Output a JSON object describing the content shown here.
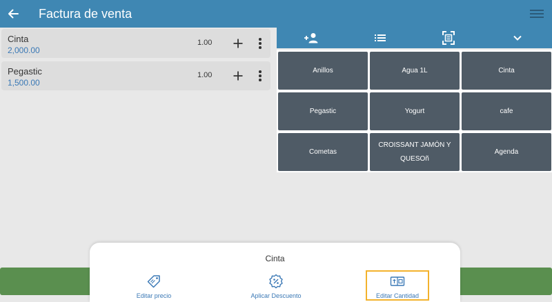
{
  "appbar": {
    "title": "Factura de venta",
    "back_icon": "arrow-left-icon",
    "menu_icon": "hamburger-menu-icon"
  },
  "invoice_lines": [
    {
      "name": "Cinta",
      "price": "2,000.00",
      "qty": "1.00"
    },
    {
      "name": "Pegastic",
      "price": "1,500.00",
      "qty": "1.00"
    }
  ],
  "toolbar": {
    "icons": [
      "add-customer-icon",
      "list-icon",
      "barcode-scan-icon",
      "chevron-down-icon"
    ]
  },
  "products": [
    "Anillos",
    "Agua 1L",
    "Cinta",
    "Pegastic",
    "Yogurt",
    "cafe",
    "Cometas",
    "CROISSANT JAMÓN Y QUESOñ",
    "Agenda"
  ],
  "sheet": {
    "title": "Cinta",
    "actions": [
      {
        "label": "Editar precio",
        "icon": "price-tag-icon",
        "selected": false
      },
      {
        "label": "Aplicar Descuento",
        "icon": "discount-badge-icon",
        "selected": false
      },
      {
        "label": "Editar Cantidad",
        "icon": "quantity-card-icon",
        "selected": true
      }
    ]
  },
  "colors": {
    "primary": "#3f87b3",
    "tile": "#4f5b66",
    "price_text": "#3a78b5",
    "action_bar": "#5a8f4f",
    "highlight": "#f3b22c"
  }
}
